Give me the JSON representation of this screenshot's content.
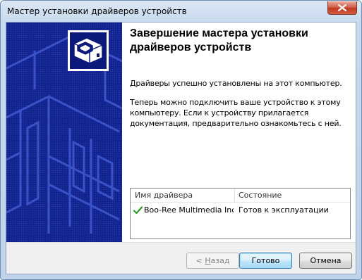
{
  "window": {
    "title": "Мастер установки драйверов устройств"
  },
  "content": {
    "heading": "Завершение мастера установки драйверов устройств",
    "paragraph1": "Драйверы успешно установлены на этот компьютер.",
    "paragraph2": "Теперь можно подключить ваше устройство к этому компьютеру. Если к устройству прилагается документация, предварительно ознакомьтесь с ней."
  },
  "driver_list": {
    "columns": [
      "Имя драйвера",
      "Состояние"
    ],
    "rows": [
      {
        "status_icon": "green-check-icon",
        "name": "Boo-Ree Multimedia Inc....",
        "state": "Готов к эксплуатации"
      }
    ]
  },
  "buttons": {
    "back_prefix": "< ",
    "back_accel": "Н",
    "back_rest": "азад",
    "finish": "Готово",
    "cancel": "Отмена"
  },
  "colors": {
    "banner": "#14248f",
    "check": "#2a9d2a"
  }
}
